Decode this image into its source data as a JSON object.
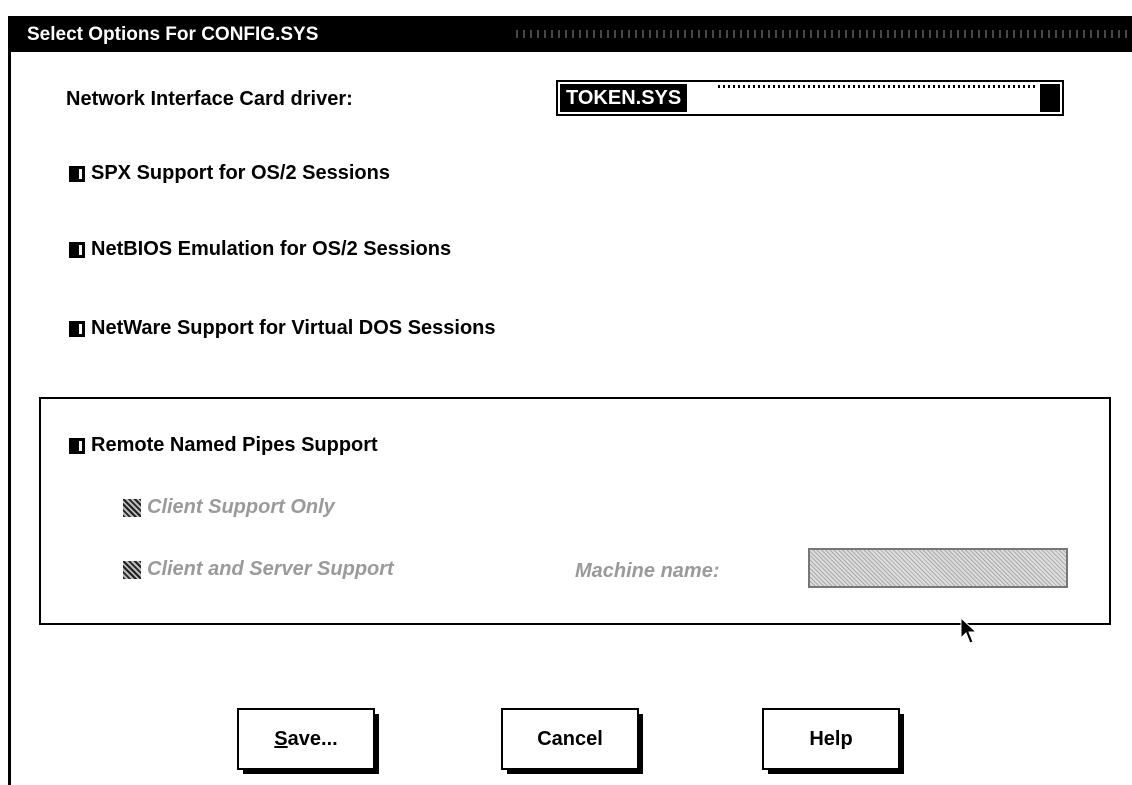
{
  "window": {
    "title": "Select Options For CONFIG.SYS"
  },
  "nic": {
    "label": "Network Interface Card driver:",
    "value": "TOKEN.SYS"
  },
  "options": {
    "spx": "SPX Support for OS/2 Sessions",
    "netbios": "NetBIOS Emulation for OS/2 Sessions",
    "netware": "NetWare Support for Virtual DOS Sessions"
  },
  "pipes": {
    "label": "Remote Named Pipes Support",
    "client_only": "Client Support Only",
    "client_server": "Client and Server Support",
    "machine_label": "Machine name:",
    "machine_value": ""
  },
  "buttons": {
    "save_rest": "ave...",
    "save_mnemonic": "S",
    "cancel": "Cancel",
    "help": "Help"
  },
  "icons": {
    "dropdown": "dropdown-arrow-icon",
    "pointer": "mouse-pointer-icon"
  }
}
